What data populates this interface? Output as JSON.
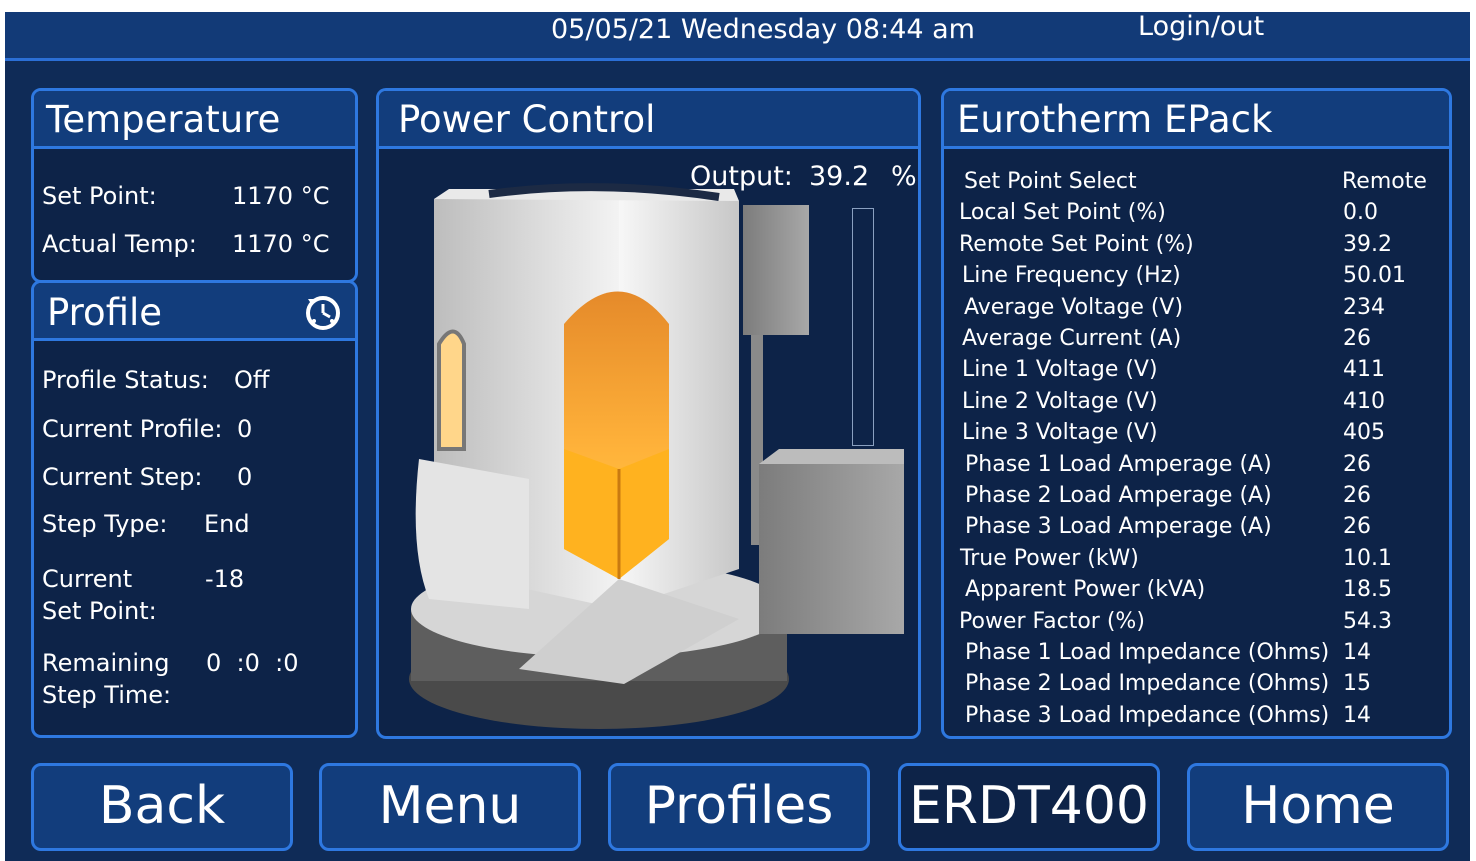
{
  "header": {
    "datetime": "05/05/21 Wednesday 08:44 am",
    "login_label": "Login/out"
  },
  "temperature": {
    "title": "Temperature",
    "set_point_label": "Set Point:",
    "set_point_value": "1170 °C",
    "actual_label": "Actual Temp:",
    "actual_value": "1170 °C"
  },
  "profile": {
    "title": "Profile",
    "icon": "clock-refresh-icon",
    "status_label": "Profile Status:",
    "status_value": "Off",
    "current_profile_label": "Current Profile:",
    "current_profile_value": "0",
    "current_step_label": "Current Step:",
    "current_step_value": "0",
    "step_type_label": "Step Type:",
    "step_type_value": "End",
    "current_sp_label_1": "Current",
    "current_sp_label_2": "Set Point:",
    "current_sp_value": "-18",
    "remaining_label_1": "Remaining",
    "remaining_label_2": "Step Time:",
    "remaining_value": "0  :0  :0"
  },
  "power": {
    "title": "Power Control",
    "output_label": "Output:",
    "output_value": "39.2",
    "output_unit": "%",
    "output_fraction": 0.0
  },
  "epack": {
    "title": "Eurotherm EPack",
    "rows": [
      {
        "label": "Set Point Select",
        "value": "Remote"
      },
      {
        "label": "Local Set Point (%)",
        "value": "0.0"
      },
      {
        "label": "Remote Set Point (%)",
        "value": "39.2"
      },
      {
        "label": "Line Frequency (Hz)",
        "value": "50.01"
      },
      {
        "label": "Average Voltage (V)",
        "value": "234"
      },
      {
        "label": "Average Current (A)",
        "value": "26"
      },
      {
        "label": "Line 1 Voltage (V)",
        "value": "411"
      },
      {
        "label": "Line 2 Voltage (V)",
        "value": "410"
      },
      {
        "label": "Line 3 Voltage (V)",
        "value": "405"
      },
      {
        "label": "Phase 1 Load Amperage (A)",
        "value": "26"
      },
      {
        "label": "Phase 2 Load Amperage (A)",
        "value": "26"
      },
      {
        "label": "Phase 3 Load Amperage (A)",
        "value": "26"
      },
      {
        "label": "True Power (kW)",
        "value": "10.1"
      },
      {
        "label": "Apparent Power (kVA)",
        "value": "18.5"
      },
      {
        "label": "Power Factor (%)",
        "value": "54.3"
      },
      {
        "label": "Phase 1 Load Impedance (Ohms)",
        "value": "14"
      },
      {
        "label": "Phase 2 Load Impedance (Ohms)",
        "value": "15"
      },
      {
        "label": "Phase 3 Load Impedance (Ohms)",
        "value": "14"
      }
    ]
  },
  "nav": {
    "back": "Back",
    "menu": "Menu",
    "profiles": "Profiles",
    "model": "ERDT400",
    "home": "Home"
  },
  "colors": {
    "background": "#0f2b57",
    "panel": "#0d2348",
    "title_bar": "#123d7c",
    "border": "#2e78e0"
  }
}
